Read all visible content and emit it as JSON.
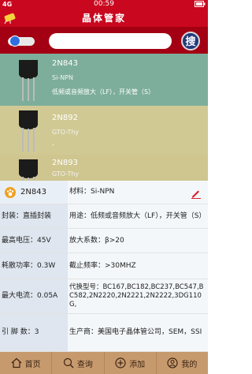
{
  "statusbar": {
    "carrier": "4G",
    "time": "00:59",
    "battery": "▭"
  },
  "title": "晶体管家",
  "search": {
    "placeholder": "",
    "button_label": "搜"
  },
  "colors": {
    "primary": "#c9071e",
    "dark_red": "#a30013",
    "nav_bg": "#c79a6e"
  },
  "list": [
    {
      "name": "2N843",
      "type": "Si-NPN",
      "desc": "低频或音频放大（LF），开关管（S）",
      "bg": "#7dae9b"
    },
    {
      "name": "2N892",
      "type": "GTO-Thy",
      "desc": "-",
      "bg": "#d1c993"
    },
    {
      "name": "2N893",
      "type": "GTO-Thy",
      "desc": "",
      "bg": "#cfc58f"
    }
  ],
  "detail": {
    "part_name": "2N843",
    "material": "材料：Si-NPN",
    "package": "封装：直插封装",
    "usage": "用途：低频或音频放大（LF），开关管（S）",
    "max_voltage": "最高电压：45V",
    "amp_factor": "放大系数：β>20",
    "power": "耗散功率：0.3W",
    "cutoff_freq": "截止频率：>30MHZ",
    "max_current": "最大电流：0.05A",
    "replacement": "代换型号：BC167,BC182,BC237,BC547,BC582,2N2220,2N2221,2N2222,3DG110G,",
    "pins": "引 脚 数：3",
    "manufacturer": "生产商：美国电子晶体管公司，SEM，SSI"
  },
  "nav": [
    {
      "label": "首页",
      "icon": "home-icon"
    },
    {
      "label": "查询",
      "icon": "search-icon"
    },
    {
      "label": "添加",
      "icon": "add-icon"
    },
    {
      "label": "我的",
      "icon": "user-icon"
    }
  ]
}
